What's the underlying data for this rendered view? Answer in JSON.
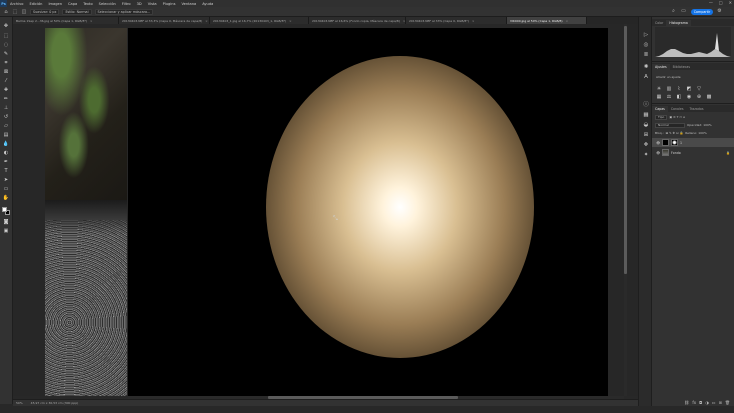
{
  "menubar": {
    "logo": "Ps",
    "items": [
      "Archivo",
      "Edición",
      "Imagen",
      "Capa",
      "Texto",
      "Selección",
      "Filtro",
      "3D",
      "Vista",
      "Plugins",
      "Ventana",
      "Ayuda"
    ],
    "window_controls": [
      "—",
      "□",
      "✕"
    ]
  },
  "options": {
    "feather": "Suavizar: 0 px",
    "style": "Estilo: Normal",
    "mask_button": "Seleccionar y aplicar máscara...",
    "share": "Compartir"
  },
  "tabs": [
    {
      "label": "Balma 1Sep 2...36.jpg al 50% (Capa 1, RGB/8*)",
      "active": false
    },
    {
      "label": "20130403.NEF al 33,3% (Capa 0, Máscara de capa/8)",
      "active": false
    },
    {
      "label": "20130403_1.jpg al 16,7% (20130403_1, RGB/8*)",
      "active": false
    },
    {
      "label": "20130403.NEF al 16,6% (Fondo copia, Máscara de capa/8)",
      "active": false
    },
    {
      "label": "20130403.NEF al 33% (Capa 0, RGB/8*)",
      "active": false
    },
    {
      "label": "VIK900.jpg al 50% (Capa 1, RGB/8)",
      "active": true
    }
  ],
  "status": {
    "zoom": "50%",
    "doc_size": "45,97 cm x 30,53 cm (300 ppp)"
  },
  "panels": {
    "top_tabs": [
      "Color",
      "Histograma"
    ],
    "adj_tabs": [
      "Ajustes",
      "Bibliotecas"
    ],
    "adj_hint": "Añadir un ajuste",
    "layer_tabs": [
      "Capas",
      "Canales",
      "Trazados"
    ],
    "kind": "Tipo",
    "blend_mode": "Normal",
    "opacity": "Opacidad: 100%",
    "lock": "Bloq.:",
    "fill": "Relleno: 100%",
    "layers": [
      {
        "name": "1",
        "selected": true
      },
      {
        "name": "Fondo",
        "selected": false
      }
    ]
  },
  "colors": {
    "glow_center": "#ffffff",
    "glow_mid": "#d9bf92",
    "accent": "#1473e6"
  }
}
